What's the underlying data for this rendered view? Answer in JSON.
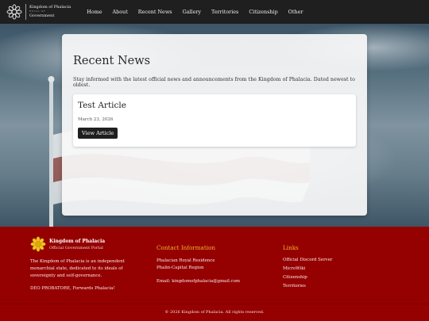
{
  "nav": {
    "logo": {
      "line1": "Kingdom of Phalacia",
      "line2": "ROYAL OF",
      "line3": "Government"
    },
    "links": [
      "Home",
      "About",
      "Recent News",
      "Gallery",
      "Territories",
      "Citizenship",
      "Other"
    ]
  },
  "main": {
    "title": "Recent News",
    "intro": "Stay informed with the latest official news and announcements from the Kingdom of Phalacia. Dated newest to oldest.",
    "articles": [
      {
        "title": "Test Article",
        "date": "March 23, 2026",
        "button": "View Article"
      }
    ]
  },
  "footer": {
    "brand": {
      "name": "Kingdom of Phalacia",
      "subtitle": "Official Government Portal"
    },
    "description": "The Kingdom of Phalacia is an independent monarchial state, dedicated to its ideals of sovereignty and self-governance.",
    "motto": "DEO PROBATORE, Forwards Phalacia!",
    "contact": {
      "heading": "Contact Information",
      "address1": "Phalacian Royal Residence",
      "address2": "Phalin-Capital Region",
      "email": "Email: kingdomofphalacia@gmail.com"
    },
    "links": {
      "heading": "Links",
      "items": [
        "Official Discord Server",
        "MicroWiki",
        "Citizenship",
        "Territories"
      ]
    },
    "copyright": "© 2026 Kingdom of Phalacia. All rights reserved."
  },
  "colors": {
    "nav_bg": "#1f1f1f",
    "footer_bg": "#950000",
    "footer_heading": "#f3b530",
    "button_bg": "#1f1f1f"
  },
  "icons": {
    "logo": "sunflower-emblem-icon"
  }
}
